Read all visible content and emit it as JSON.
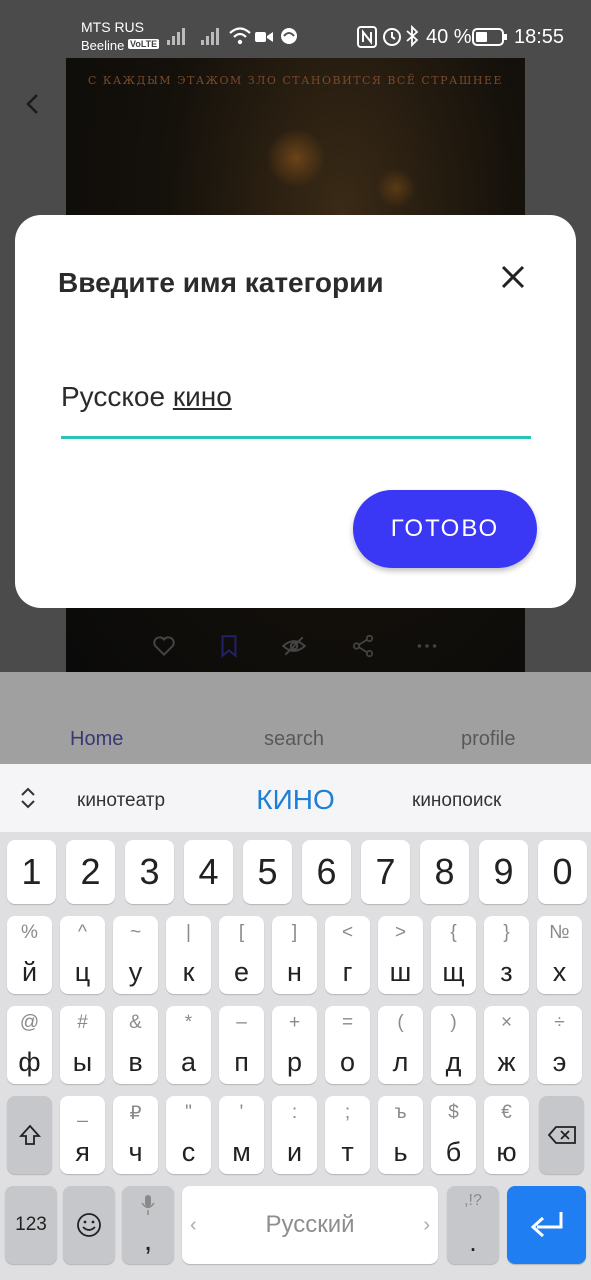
{
  "status": {
    "carrier_top": "MTS RUS",
    "carrier_bottom": "Beeline",
    "volte": "VoLTE",
    "battery": "40 %",
    "time": "18:55"
  },
  "poster": {
    "tagline": "С КАЖДЫМ ЭТАЖОМ ЗЛО СТАНОВИТСЯ ВСЁ СТРАШНЕЕ"
  },
  "bottom_nav": {
    "items": [
      "Home",
      "search",
      "profile"
    ]
  },
  "dialog": {
    "title": "Введите имя категории",
    "input_value_prefix": "Русское ",
    "input_value_underlined": "кино",
    "done_label": "ГОТОВО"
  },
  "keyboard": {
    "suggestions": {
      "left": "кинотеатр",
      "center": "КИНО",
      "right": "кинопоиск"
    },
    "number_row": [
      "1",
      "2",
      "3",
      "4",
      "5",
      "6",
      "7",
      "8",
      "9",
      "0"
    ],
    "row1": {
      "main": [
        "й",
        "ц",
        "у",
        "к",
        "е",
        "н",
        "г",
        "ш",
        "щ",
        "з",
        "х"
      ],
      "sub": [
        "%",
        "^",
        "~",
        "|",
        "[",
        "]",
        "<",
        ">",
        "{",
        "}",
        "№"
      ]
    },
    "row2": {
      "main": [
        "ф",
        "ы",
        "в",
        "а",
        "п",
        "р",
        "о",
        "л",
        "д",
        "ж",
        "э"
      ],
      "sub": [
        "@",
        "#",
        "&",
        "*",
        "–",
        "+",
        "=",
        "(",
        ")",
        "×",
        "÷"
      ]
    },
    "row3": {
      "main": [
        "я",
        "ч",
        "с",
        "м",
        "и",
        "т",
        "ь",
        "б",
        "ю"
      ],
      "sub": [
        "_",
        "₽",
        "\"",
        "'",
        ":",
        ";",
        "ъ",
        "$",
        "€"
      ]
    },
    "bottom": {
      "mode": "123",
      "comma": ",",
      "space_label": "Русский",
      "period": ".",
      "period_sub": ",!?"
    }
  },
  "colors": {
    "accent_button": "#3a37f5",
    "input_underline": "#2bc4b8",
    "suggestion_highlight": "#1e7fd6",
    "enter_key": "#1f7ff2"
  }
}
